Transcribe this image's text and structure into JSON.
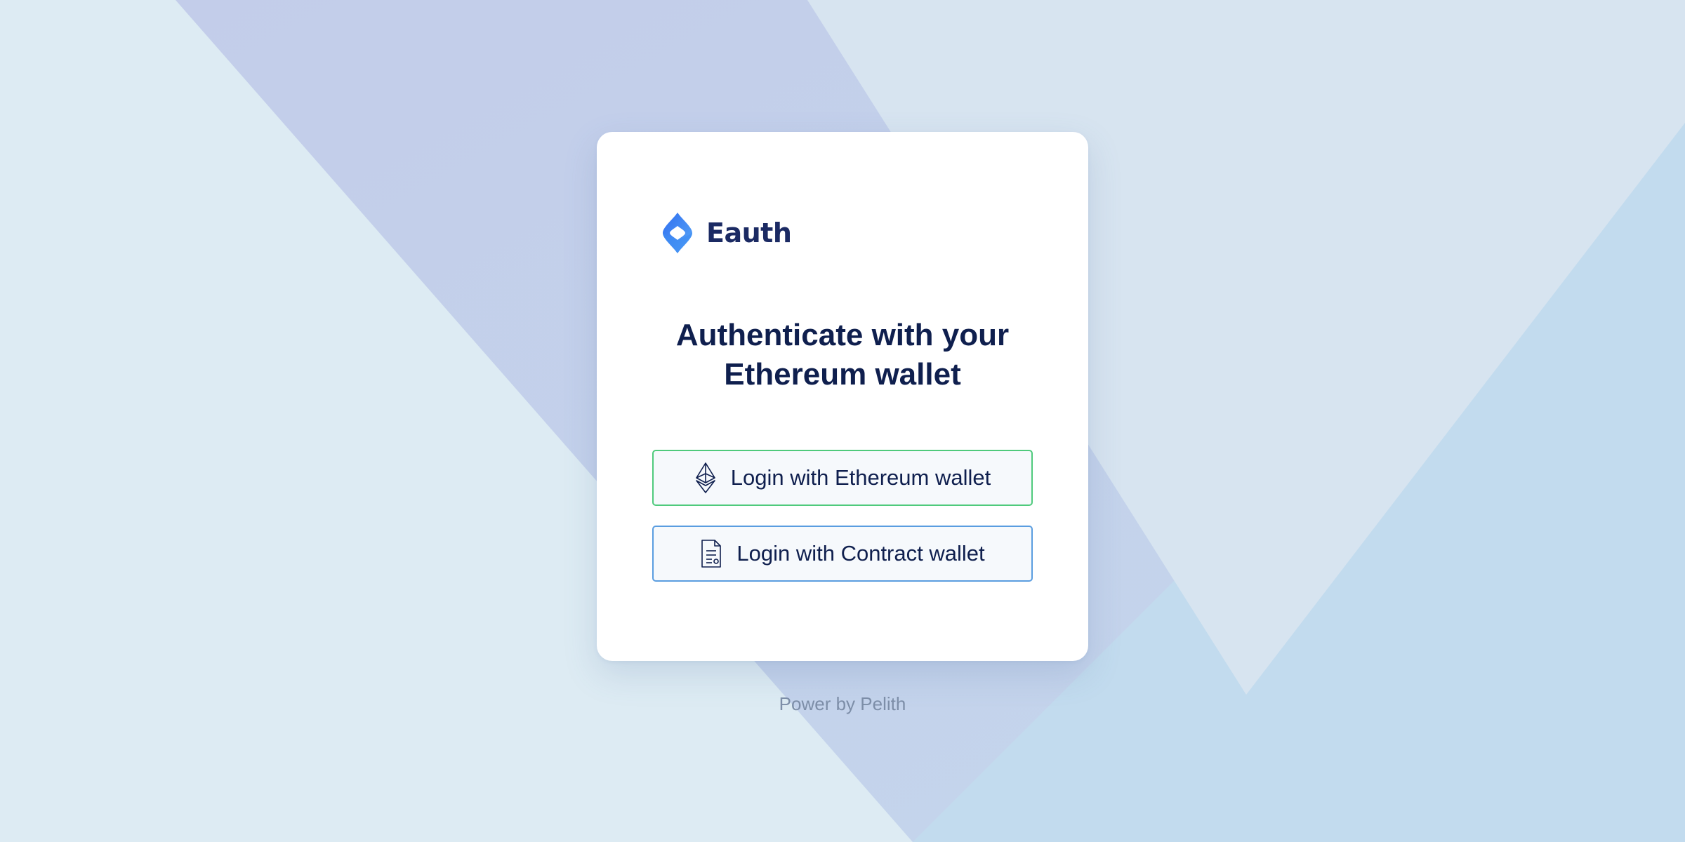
{
  "colors": {
    "background": "#ddeaf3",
    "card": "#ffffff",
    "brand_text": "#1b2a63",
    "headline": "#0f1f4e",
    "eth_button_border": "#4fca7c",
    "contract_button_border": "#5a9de0",
    "footer_text": "#7d8ea8"
  },
  "brand": {
    "name": "Eauth",
    "logo_icon": "eauth-logo-icon"
  },
  "headline": {
    "line1": "Authenticate with your",
    "line2": "Ethereum wallet"
  },
  "buttons": {
    "ethereum": {
      "label": "Login with Ethereum wallet",
      "icon": "ethereum-icon"
    },
    "contract": {
      "label": "Login with Contract wallet",
      "icon": "document-icon"
    }
  },
  "footer": {
    "text": "Power by Pelith"
  }
}
